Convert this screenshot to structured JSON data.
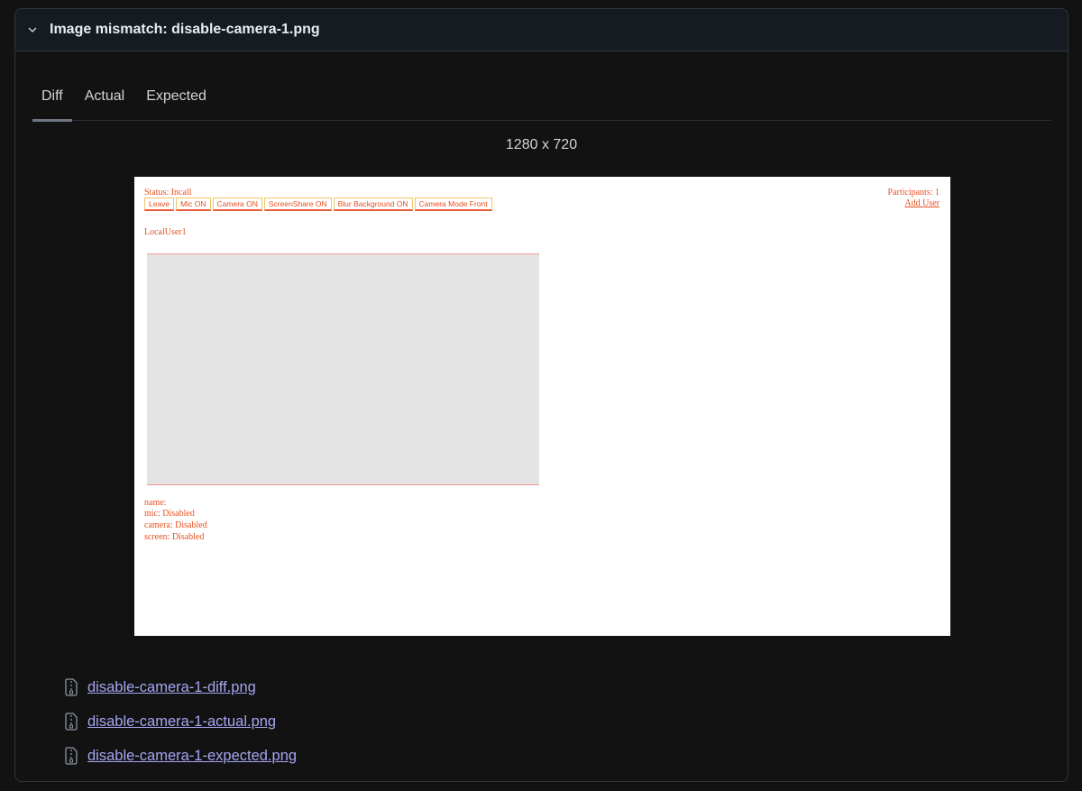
{
  "panel": {
    "title": "Image mismatch: disable-camera-1.png",
    "collapse_icon": "chevron-down-icon"
  },
  "tabs": [
    {
      "label": "Diff",
      "active": true
    },
    {
      "label": "Actual",
      "active": false
    },
    {
      "label": "Expected",
      "active": false
    }
  ],
  "image_dimensions": "1280 x 720",
  "diff_image": {
    "status": "Status: Incall",
    "buttons": [
      "Leave",
      "Mic ON",
      "Camera ON",
      "ScreenShare ON",
      "Blur Background ON",
      "Camera Mode Front"
    ],
    "participants": "Participants: 1",
    "add_user": "Add User",
    "local_user": "LocalUser1",
    "info": [
      "name:",
      "mic: Disabled",
      "camera: Disabled",
      "screen: Disabled"
    ],
    "colors": {
      "diff_highlight": "#e8501f",
      "video_bg": "#e4e4e4"
    }
  },
  "attachments": [
    {
      "name": "disable-camera-1-diff.png",
      "icon": "file-zip-icon"
    },
    {
      "name": "disable-camera-1-actual.png",
      "icon": "file-zip-icon"
    },
    {
      "name": "disable-camera-1-expected.png",
      "icon": "file-zip-icon"
    }
  ]
}
